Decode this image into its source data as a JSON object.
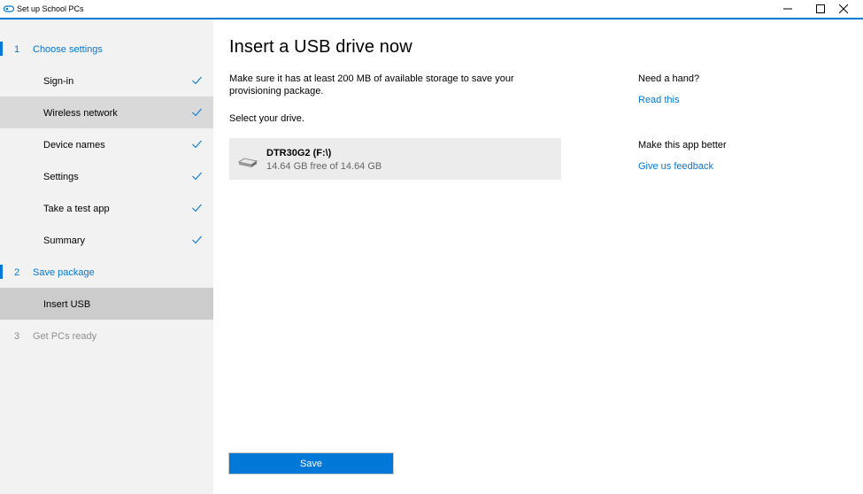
{
  "window": {
    "title": "Set up School PCs"
  },
  "sidebar": {
    "steps": [
      {
        "number": "1",
        "label": "Choose settings"
      },
      {
        "number": "2",
        "label": "Save package"
      },
      {
        "number": "3",
        "label": "Get PCs ready"
      }
    ],
    "choose_settings_items": [
      {
        "label": "Sign-in",
        "completed": true
      },
      {
        "label": "Wireless network",
        "completed": true
      },
      {
        "label": "Device names",
        "completed": true
      },
      {
        "label": "Settings",
        "completed": true
      },
      {
        "label": "Take a test app",
        "completed": true
      },
      {
        "label": "Summary",
        "completed": true
      }
    ],
    "save_package_items": [
      {
        "label": "Insert USB",
        "current": true
      }
    ]
  },
  "main": {
    "heading": "Insert a USB drive now",
    "description": "Make sure it has at least 200 MB of available storage to save your provisioning package.",
    "select_label": "Select your drive.",
    "drive": {
      "name": "DTR30G2 (F:\\)",
      "free_space": "14.64 GB free of 14.64 GB"
    },
    "save_label": "Save"
  },
  "help": {
    "title": "Need a hand?",
    "link": "Read this",
    "better_title": "Make this app better",
    "feedback_link": "Give us feedback"
  },
  "colors": {
    "accent": "#0078d7",
    "sidebar_bg": "#f2f2f2",
    "selected_bg": "#d9d9d9"
  }
}
